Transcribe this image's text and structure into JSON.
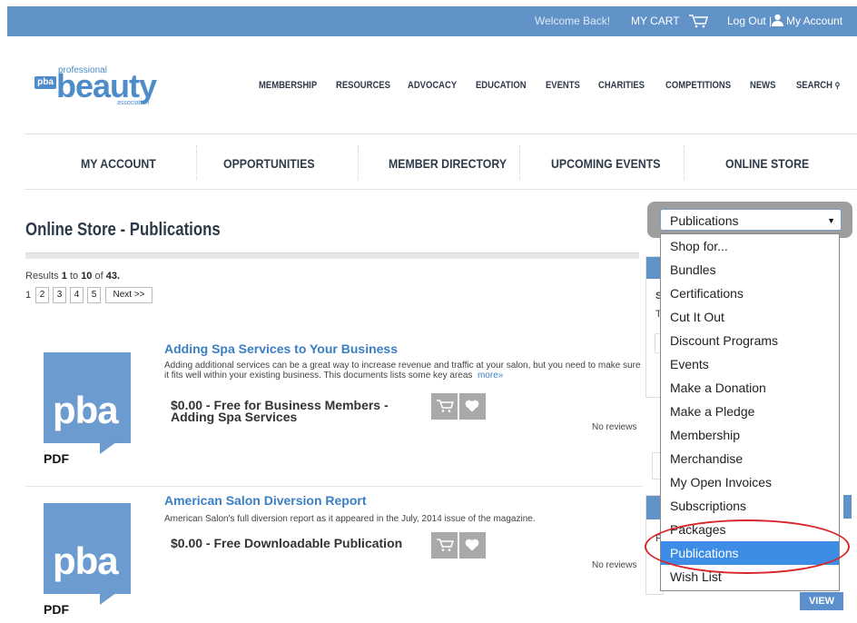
{
  "topbar": {
    "welcome": "Welcome Back!",
    "cart": "MY CART",
    "logout": "Log Out |",
    "account": "My Account"
  },
  "logo": {
    "professional": "professional",
    "beauty": "beauty",
    "pba": "pba",
    "association": "association"
  },
  "main_nav": [
    "MEMBERSHIP",
    "RESOURCES",
    "ADVOCACY",
    "EDUCATION",
    "EVENTS",
    "CHARITIES",
    "COMPETITIONS",
    "NEWS",
    "SEARCH"
  ],
  "sub_nav": [
    "MY ACCOUNT",
    "OPPORTUNITIES",
    "MEMBER DIRECTORY",
    "UPCOMING EVENTS",
    "ONLINE STORE"
  ],
  "page_title": "Online Store - Publications",
  "results": {
    "prefix": "Results",
    "from": "1",
    "to_word": "to",
    "to": "10",
    "of_word": "of",
    "total": "43."
  },
  "pager": {
    "current": "1",
    "pages": [
      "2",
      "3",
      "4",
      "5"
    ],
    "next": "Next >>"
  },
  "products": [
    {
      "title": "Adding Spa Services to Your Business",
      "description": "Adding additional services can be a great way to increase revenue and traffic at your salon, but you need to make sure it fits well within your existing business. This documents lists some key areas",
      "more": "more»",
      "price": "$0.00 - Free for Business Members - Adding Spa Services",
      "reviews": "No reviews",
      "thumb_text": "pba",
      "format": "PDF"
    },
    {
      "title": "American Salon Diversion Report",
      "description": "American Salon's full diversion report as it appeared in the July, 2014 issue of the magazine.",
      "more": "",
      "price": "$0.00 - Free Downloadable Publication",
      "reviews": "No reviews",
      "thumb_text": "pba",
      "format": "PDF"
    }
  ],
  "dropdown": {
    "selected": "Publications",
    "options": [
      "Shop for...",
      "Bundles",
      "Certifications",
      "Cut It Out",
      "Discount Programs",
      "Events",
      "Make a Donation",
      "Make a Pledge",
      "Membership",
      "Merchandise",
      "My Open Invoices",
      "Subscriptions",
      "Packages",
      "Publications",
      "Wish List"
    ],
    "highlighted_index": 13
  },
  "sidebar_fragments": {
    "s": "S",
    "t": "T",
    "f": "F"
  },
  "view_button": "VIEW",
  "colors": {
    "topbar": "#6193c9",
    "link": "#3a7ec4",
    "highlight": "#3d8ce6",
    "annotation": "#d9262a"
  }
}
